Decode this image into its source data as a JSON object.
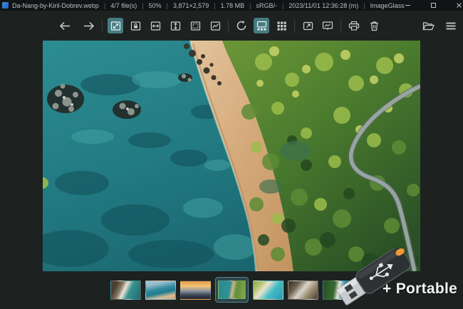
{
  "titlebar": {
    "app_icon": "imageglass-logo-icon",
    "separator": "|",
    "segments": [
      "Da-Nang-by-Kiril-Dobrev.webp",
      "4/7 file(s)",
      "50%",
      "3,871×2,579",
      "1.78 MB",
      "sRGB/-",
      "2023/11/01 12:36:28 (m)",
      "ImageGlass"
    ],
    "controls": [
      "minimize",
      "maximize",
      "close"
    ]
  },
  "toolbar": {
    "left_items": [
      "back",
      "forward"
    ],
    "zoom_modes": [
      "auto-zoom",
      "lock-zoom",
      "scale-to-width",
      "scale-to-height",
      "scale-to-fit",
      "scale-to-fill"
    ],
    "view_items": [
      "refresh",
      "thumbnail-bar",
      "checkerboard"
    ],
    "window_items": [
      "fullscreen",
      "slideshow"
    ],
    "action_items": [
      "print",
      "delete"
    ],
    "right_items": [
      "open-file",
      "main-menu"
    ],
    "active_items": [
      "auto-zoom",
      "thumbnail-bar"
    ]
  },
  "viewer": {
    "image_name": "Da-Nang-by-Kiril-Dobrev.webp",
    "zoom_level": "50%",
    "description": "Aerial drone photo of Da Nang coastline: turquoise sea with scattered rocks on the left, curving sandy beach in the middle, dense green forest with a winding road on the right"
  },
  "thumbnail_bar": {
    "selected_index": 3,
    "items": [
      {
        "name": "thumb-waves-on-rocks"
      },
      {
        "name": "thumb-coastline-aerial"
      },
      {
        "name": "thumb-sunset-boats"
      },
      {
        "name": "thumb-danang-coast-current"
      },
      {
        "name": "thumb-turquoise-beach"
      },
      {
        "name": "thumb-rocky-surf"
      },
      {
        "name": "thumb-green-coast-aerial"
      }
    ]
  },
  "overlay": {
    "icon": "usb-drive-icon",
    "label": "+ Portable"
  },
  "colors": {
    "accent_teal": "#477c83",
    "titlebar_bg": "#101414",
    "app_bg": "#1d2221",
    "toolbar_icon": "#c9cfce",
    "usb_led": "#ef8e2e"
  }
}
